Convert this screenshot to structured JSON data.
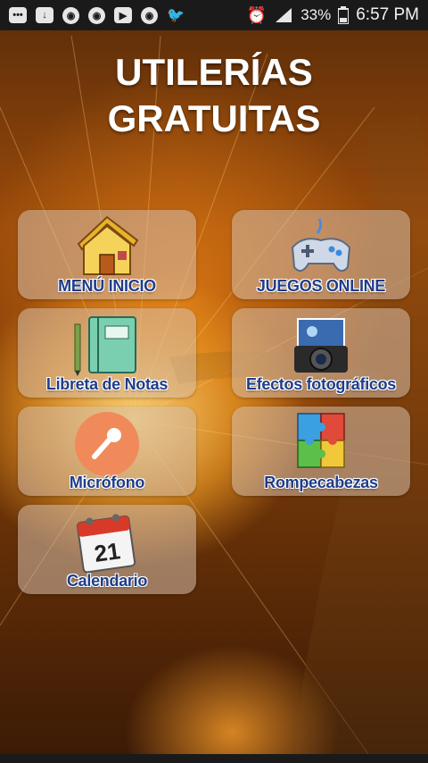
{
  "status_bar": {
    "battery_percent": "33%",
    "time": "6:57 PM"
  },
  "app": {
    "title_line1": "UTILERÍAS",
    "title_line2": "GRATUITAS"
  },
  "menu": {
    "items": [
      {
        "label": "MENÚ INICIO",
        "icon": "house-icon"
      },
      {
        "label": "JUEGOS ONLINE",
        "icon": "gamepad-icon"
      },
      {
        "label": "Libreta de Notas",
        "icon": "notebook-icon"
      },
      {
        "label": "Efectos fotográficos",
        "icon": "camera-icon"
      },
      {
        "label": "Micrófono",
        "icon": "microphone-icon"
      },
      {
        "label": "Rompecabezas",
        "icon": "puzzle-icon"
      },
      {
        "label": "Calendario",
        "icon": "calendar-icon",
        "day": "21"
      }
    ]
  },
  "colors": {
    "label": "#1f3d8a",
    "tile_bg": "rgba(214,190,170,0.55)",
    "mic_circle": "#f08a5a"
  }
}
